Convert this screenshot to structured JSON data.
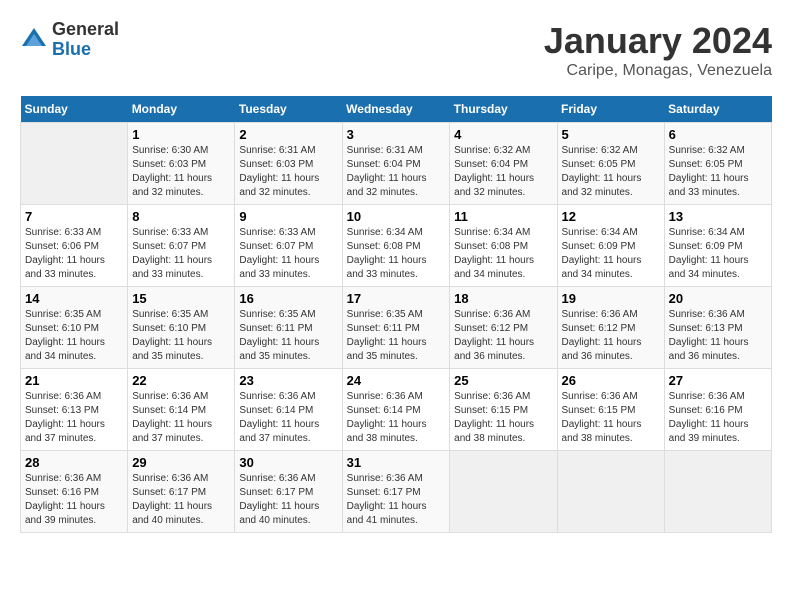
{
  "logo": {
    "general": "General",
    "blue": "Blue"
  },
  "title": "January 2024",
  "subtitle": "Caripe, Monagas, Venezuela",
  "days_of_week": [
    "Sunday",
    "Monday",
    "Tuesday",
    "Wednesday",
    "Thursday",
    "Friday",
    "Saturday"
  ],
  "weeks": [
    [
      {
        "day": "",
        "sunrise": "",
        "sunset": "",
        "daylight": ""
      },
      {
        "day": "1",
        "sunrise": "Sunrise: 6:30 AM",
        "sunset": "Sunset: 6:03 PM",
        "daylight": "Daylight: 11 hours and 32 minutes."
      },
      {
        "day": "2",
        "sunrise": "Sunrise: 6:31 AM",
        "sunset": "Sunset: 6:03 PM",
        "daylight": "Daylight: 11 hours and 32 minutes."
      },
      {
        "day": "3",
        "sunrise": "Sunrise: 6:31 AM",
        "sunset": "Sunset: 6:04 PM",
        "daylight": "Daylight: 11 hours and 32 minutes."
      },
      {
        "day": "4",
        "sunrise": "Sunrise: 6:32 AM",
        "sunset": "Sunset: 6:04 PM",
        "daylight": "Daylight: 11 hours and 32 minutes."
      },
      {
        "day": "5",
        "sunrise": "Sunrise: 6:32 AM",
        "sunset": "Sunset: 6:05 PM",
        "daylight": "Daylight: 11 hours and 32 minutes."
      },
      {
        "day": "6",
        "sunrise": "Sunrise: 6:32 AM",
        "sunset": "Sunset: 6:05 PM",
        "daylight": "Daylight: 11 hours and 33 minutes."
      }
    ],
    [
      {
        "day": "7",
        "sunrise": "Sunrise: 6:33 AM",
        "sunset": "Sunset: 6:06 PM",
        "daylight": "Daylight: 11 hours and 33 minutes."
      },
      {
        "day": "8",
        "sunrise": "Sunrise: 6:33 AM",
        "sunset": "Sunset: 6:07 PM",
        "daylight": "Daylight: 11 hours and 33 minutes."
      },
      {
        "day": "9",
        "sunrise": "Sunrise: 6:33 AM",
        "sunset": "Sunset: 6:07 PM",
        "daylight": "Daylight: 11 hours and 33 minutes."
      },
      {
        "day": "10",
        "sunrise": "Sunrise: 6:34 AM",
        "sunset": "Sunset: 6:08 PM",
        "daylight": "Daylight: 11 hours and 33 minutes."
      },
      {
        "day": "11",
        "sunrise": "Sunrise: 6:34 AM",
        "sunset": "Sunset: 6:08 PM",
        "daylight": "Daylight: 11 hours and 34 minutes."
      },
      {
        "day": "12",
        "sunrise": "Sunrise: 6:34 AM",
        "sunset": "Sunset: 6:09 PM",
        "daylight": "Daylight: 11 hours and 34 minutes."
      },
      {
        "day": "13",
        "sunrise": "Sunrise: 6:34 AM",
        "sunset": "Sunset: 6:09 PM",
        "daylight": "Daylight: 11 hours and 34 minutes."
      }
    ],
    [
      {
        "day": "14",
        "sunrise": "Sunrise: 6:35 AM",
        "sunset": "Sunset: 6:10 PM",
        "daylight": "Daylight: 11 hours and 34 minutes."
      },
      {
        "day": "15",
        "sunrise": "Sunrise: 6:35 AM",
        "sunset": "Sunset: 6:10 PM",
        "daylight": "Daylight: 11 hours and 35 minutes."
      },
      {
        "day": "16",
        "sunrise": "Sunrise: 6:35 AM",
        "sunset": "Sunset: 6:11 PM",
        "daylight": "Daylight: 11 hours and 35 minutes."
      },
      {
        "day": "17",
        "sunrise": "Sunrise: 6:35 AM",
        "sunset": "Sunset: 6:11 PM",
        "daylight": "Daylight: 11 hours and 35 minutes."
      },
      {
        "day": "18",
        "sunrise": "Sunrise: 6:36 AM",
        "sunset": "Sunset: 6:12 PM",
        "daylight": "Daylight: 11 hours and 36 minutes."
      },
      {
        "day": "19",
        "sunrise": "Sunrise: 6:36 AM",
        "sunset": "Sunset: 6:12 PM",
        "daylight": "Daylight: 11 hours and 36 minutes."
      },
      {
        "day": "20",
        "sunrise": "Sunrise: 6:36 AM",
        "sunset": "Sunset: 6:13 PM",
        "daylight": "Daylight: 11 hours and 36 minutes."
      }
    ],
    [
      {
        "day": "21",
        "sunrise": "Sunrise: 6:36 AM",
        "sunset": "Sunset: 6:13 PM",
        "daylight": "Daylight: 11 hours and 37 minutes."
      },
      {
        "day": "22",
        "sunrise": "Sunrise: 6:36 AM",
        "sunset": "Sunset: 6:14 PM",
        "daylight": "Daylight: 11 hours and 37 minutes."
      },
      {
        "day": "23",
        "sunrise": "Sunrise: 6:36 AM",
        "sunset": "Sunset: 6:14 PM",
        "daylight": "Daylight: 11 hours and 37 minutes."
      },
      {
        "day": "24",
        "sunrise": "Sunrise: 6:36 AM",
        "sunset": "Sunset: 6:14 PM",
        "daylight": "Daylight: 11 hours and 38 minutes."
      },
      {
        "day": "25",
        "sunrise": "Sunrise: 6:36 AM",
        "sunset": "Sunset: 6:15 PM",
        "daylight": "Daylight: 11 hours and 38 minutes."
      },
      {
        "day": "26",
        "sunrise": "Sunrise: 6:36 AM",
        "sunset": "Sunset: 6:15 PM",
        "daylight": "Daylight: 11 hours and 38 minutes."
      },
      {
        "day": "27",
        "sunrise": "Sunrise: 6:36 AM",
        "sunset": "Sunset: 6:16 PM",
        "daylight": "Daylight: 11 hours and 39 minutes."
      }
    ],
    [
      {
        "day": "28",
        "sunrise": "Sunrise: 6:36 AM",
        "sunset": "Sunset: 6:16 PM",
        "daylight": "Daylight: 11 hours and 39 minutes."
      },
      {
        "day": "29",
        "sunrise": "Sunrise: 6:36 AM",
        "sunset": "Sunset: 6:17 PM",
        "daylight": "Daylight: 11 hours and 40 minutes."
      },
      {
        "day": "30",
        "sunrise": "Sunrise: 6:36 AM",
        "sunset": "Sunset: 6:17 PM",
        "daylight": "Daylight: 11 hours and 40 minutes."
      },
      {
        "day": "31",
        "sunrise": "Sunrise: 6:36 AM",
        "sunset": "Sunset: 6:17 PM",
        "daylight": "Daylight: 11 hours and 41 minutes."
      },
      {
        "day": "",
        "sunrise": "",
        "sunset": "",
        "daylight": ""
      },
      {
        "day": "",
        "sunrise": "",
        "sunset": "",
        "daylight": ""
      },
      {
        "day": "",
        "sunrise": "",
        "sunset": "",
        "daylight": ""
      }
    ]
  ]
}
